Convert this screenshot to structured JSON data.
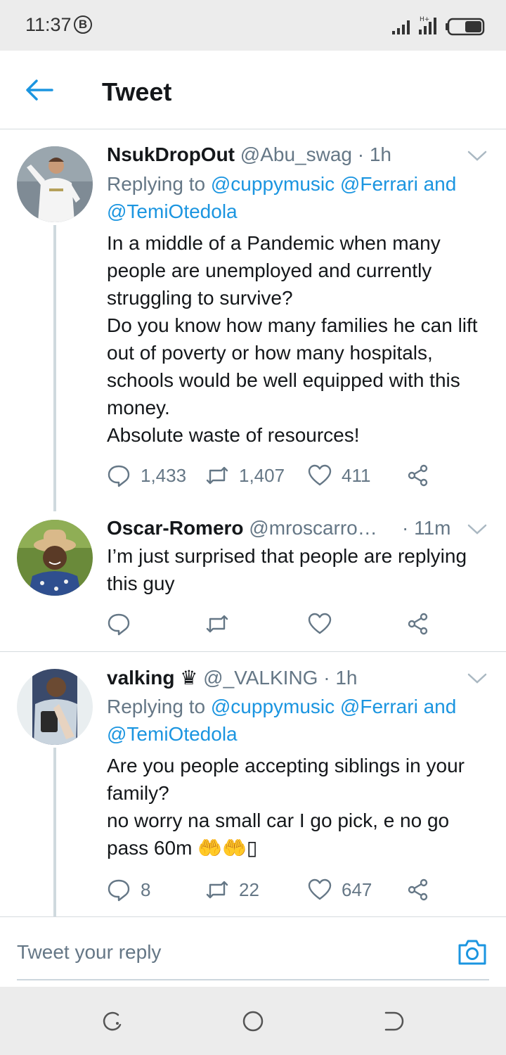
{
  "status_bar": {
    "time": "11:37",
    "b_badge": "B"
  },
  "header": {
    "title": "Tweet"
  },
  "tweets": [
    {
      "name": "NsukDropOut",
      "handle": "@Abu_swag",
      "time": "· 1h",
      "replying_prefix": "Replying to",
      "mention_1": "@cuppymusic",
      "mention_2": "@Ferrari",
      "and_word": "and",
      "mention_3": "@TemiOtedola",
      "lines": [
        "In a middle of a Pandemic when many people are unemployed and currently struggling to survive?",
        "Do you know how many families he can lift out of poverty or how many hospitals, schools would be well equipped with this money.",
        "Absolute waste of resources!"
      ],
      "replies": "1,433",
      "retweets": "1,407",
      "likes": "411"
    },
    {
      "name": "Oscar-Romero",
      "handle": "@mroscarro…",
      "time": "· 11m",
      "lines": [
        "I’m just surprised that people are replying this guy"
      ]
    },
    {
      "name": "valking",
      "crown": "♛",
      "handle": "@_VALKING",
      "time": "· 1h",
      "replying_prefix": "Replying to",
      "mention_1": "@cuppymusic",
      "mention_2": "@Ferrari",
      "and_word": "and",
      "mention_3": "@TemiOtedola",
      "lines": [
        "Are you people accepting siblings in your family?",
        "no worry na small car I go pick, e no go pass 60m 🤲🤲"
      ],
      "trailing_glyph": "▯",
      "replies": "8",
      "retweets": "22",
      "likes": "647"
    }
  ],
  "reply_bar": {
    "placeholder": "Tweet your reply"
  },
  "colors": {
    "accent": "#1b95e0",
    "muted": "#657786",
    "text": "#14171a"
  }
}
